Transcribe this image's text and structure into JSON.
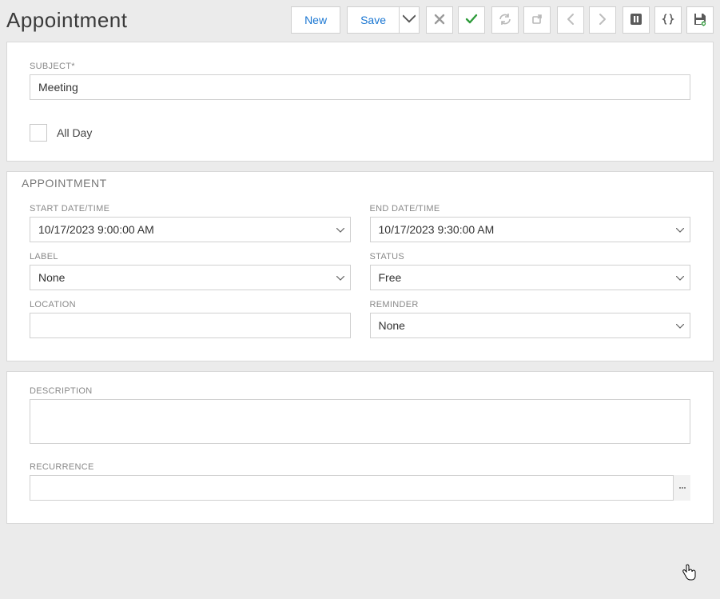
{
  "page_title": "Appointment",
  "toolbar": {
    "new_label": "New",
    "save_label": "Save"
  },
  "subject": {
    "label": "SUBJECT*",
    "value": "Meeting"
  },
  "all_day": {
    "label": "All Day",
    "checked": false
  },
  "section_title": "APPOINTMENT",
  "start": {
    "label": "START DATE/TIME",
    "value": "10/17/2023 9:00:00 AM"
  },
  "end": {
    "label": "END DATE/TIME",
    "value": "10/17/2023 9:30:00 AM"
  },
  "label_field": {
    "label": "LABEL",
    "value": "None"
  },
  "status": {
    "label": "STATUS",
    "value": "Free"
  },
  "location": {
    "label": "LOCATION",
    "value": ""
  },
  "reminder": {
    "label": "REMINDER",
    "value": "None"
  },
  "description": {
    "label": "DESCRIPTION",
    "value": ""
  },
  "recurrence": {
    "label": "RECURRENCE",
    "value": ""
  },
  "icons": {
    "close": "close-icon",
    "check": "check-icon",
    "refresh": "refresh-icon",
    "export": "export-icon",
    "prev": "chevron-left-icon",
    "next": "chevron-right-icon",
    "pause": "pause-icon",
    "braces": "braces-icon",
    "save_disk": "save-disk-icon"
  }
}
